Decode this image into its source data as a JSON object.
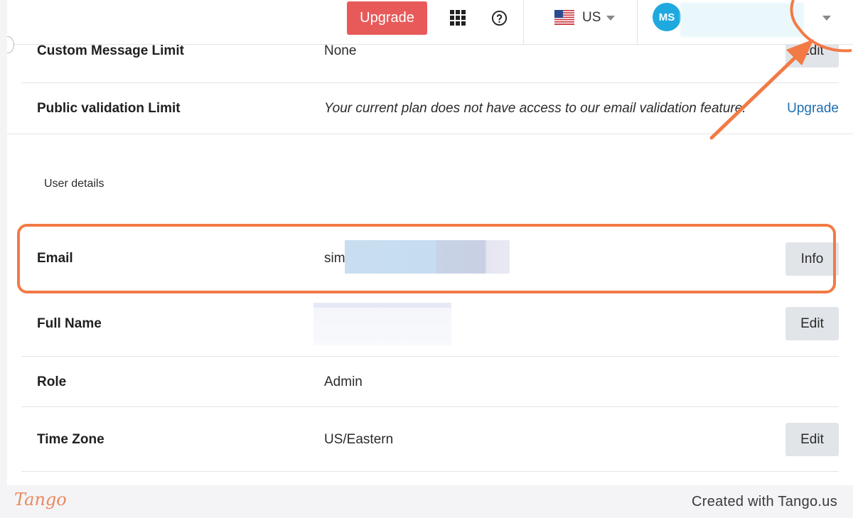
{
  "topbar": {
    "upgrade_label": "Upgrade",
    "apps_icon": "apps-grid-icon",
    "help_icon": "help-circle-icon",
    "country_flag": "us-flag-icon",
    "country_label": "US",
    "avatar_initials": "MS",
    "avatar_color": "#1fa9df"
  },
  "plan_rows": [
    {
      "label": "Custom Message Limit",
      "value": "None",
      "action": "Edit"
    },
    {
      "label": "Public validation Limit",
      "value": "Your current plan does not have access to our email validation feature.",
      "action": "Upgrade"
    }
  ],
  "user_details": {
    "section_title": "User details",
    "rows": [
      {
        "label": "Email",
        "value": "sim",
        "action": "Info"
      },
      {
        "label": "Full Name",
        "value": "",
        "action": "Edit"
      },
      {
        "label": "Role",
        "value": "Admin",
        "action": ""
      },
      {
        "label": "Time Zone",
        "value": "US/Eastern",
        "action": "Edit"
      }
    ]
  },
  "footer": {
    "logo": "Tango",
    "credit": "Created with Tango.us"
  },
  "colors": {
    "accent_annotation": "#f27a45",
    "upgrade_button": "#e85a5a",
    "link": "#1f6fb0"
  }
}
